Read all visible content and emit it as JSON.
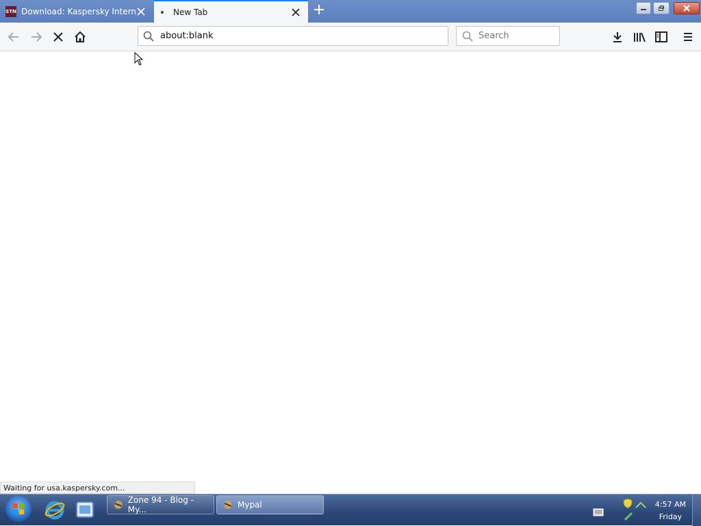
{
  "browser": {
    "tabs": [
      {
        "title": "Download: Kaspersky Internet S",
        "favicon": "STN",
        "active": false
      },
      {
        "title": "New Tab",
        "active": true
      }
    ],
    "url": "about:blank",
    "search_placeholder": "Search",
    "status_text": "Waiting for usa.kaspersky.com..."
  },
  "taskbar": {
    "tasks": [
      {
        "label": "Zone 94 - Blog - My..."
      },
      {
        "label": "Mypal"
      }
    ],
    "clock": {
      "time": "4:57 AM",
      "day": "Friday"
    }
  },
  "colors": {
    "accent": "#0a84ff",
    "taskbar": "#2c4777"
  },
  "icons": [
    "back-icon",
    "forward-icon",
    "stop-icon",
    "home-icon",
    "search-icon",
    "download-icon",
    "library-icon",
    "sidebar-icon",
    "menu-icon",
    "ie-icon",
    "explorer-icon"
  ]
}
